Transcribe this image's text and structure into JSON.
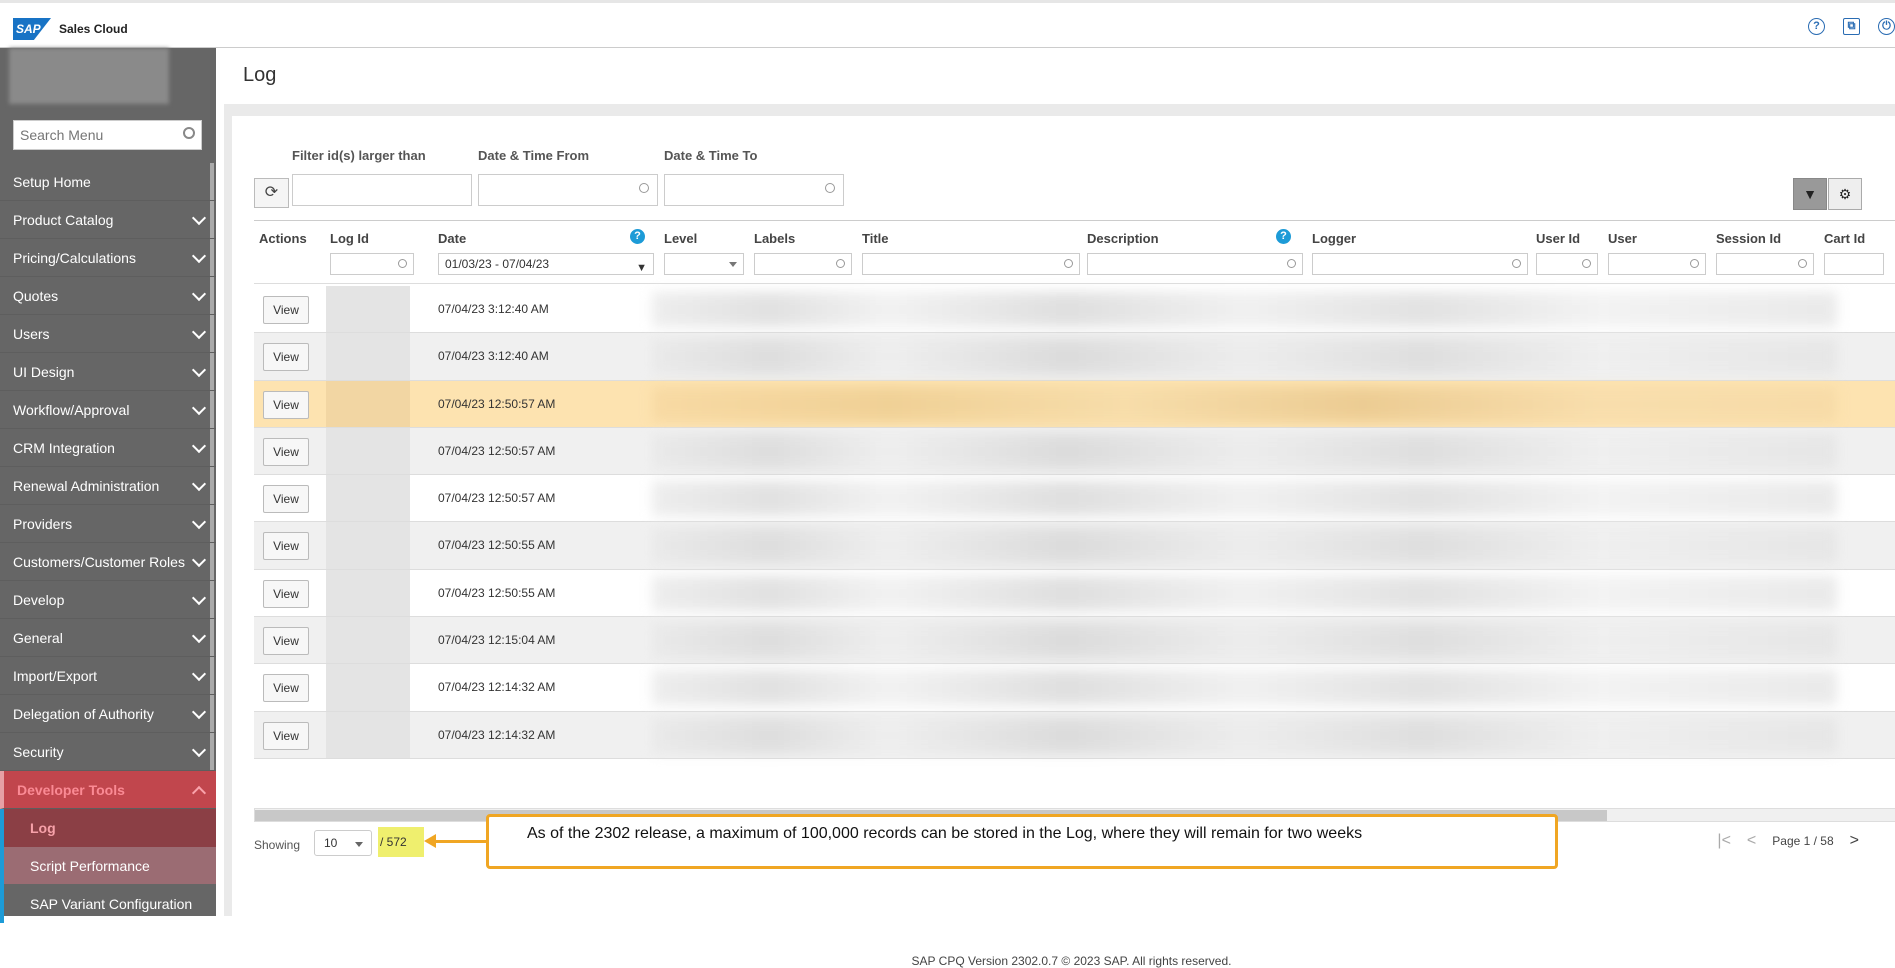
{
  "app": {
    "logo": "SAP",
    "name": "Sales Cloud"
  },
  "top_icons": [
    "help-icon",
    "external-window-icon",
    "power-icon"
  ],
  "sidebar": {
    "search_placeholder": "Search Menu",
    "items": [
      {
        "label": "Setup Home",
        "has_chevron": false
      },
      {
        "label": "Product Catalog",
        "has_chevron": true
      },
      {
        "label": "Pricing/Calculations",
        "has_chevron": true
      },
      {
        "label": "Quotes",
        "has_chevron": true
      },
      {
        "label": "Users",
        "has_chevron": true
      },
      {
        "label": "UI Design",
        "has_chevron": true
      },
      {
        "label": "Workflow/Approval",
        "has_chevron": true
      },
      {
        "label": "CRM Integration",
        "has_chevron": true
      },
      {
        "label": "Renewal Administration",
        "has_chevron": true
      },
      {
        "label": "Providers",
        "has_chevron": true
      },
      {
        "label": "Customers/Customer Roles",
        "has_chevron": true
      },
      {
        "label": "Develop",
        "has_chevron": true
      },
      {
        "label": "General",
        "has_chevron": true
      },
      {
        "label": "Import/Export",
        "has_chevron": true
      },
      {
        "label": "Delegation of Authority",
        "has_chevron": true
      },
      {
        "label": "Security",
        "has_chevron": true
      },
      {
        "label": "Developer Tools",
        "has_chevron": true,
        "active": true
      }
    ],
    "sub_items": [
      {
        "label": "Log",
        "current": true
      },
      {
        "label": "Script Performance",
        "current": false
      },
      {
        "label": "SAP Variant Configuration",
        "current": false
      }
    ]
  },
  "page": {
    "title": "Log"
  },
  "filters": {
    "id_label": "Filter id(s) larger than",
    "from_label": "Date & Time From",
    "to_label": "Date & Time To",
    "id_value": "",
    "from_value": "",
    "to_value": ""
  },
  "grid": {
    "columns": {
      "actions": "Actions",
      "log_id": "Log Id",
      "date": "Date",
      "level": "Level",
      "labels": "Labels",
      "title": "Title",
      "description": "Description",
      "logger": "Logger",
      "user_id": "User Id",
      "user": "User",
      "session_id": "Session Id",
      "cart_id": "Cart Id"
    },
    "date_filter_value": "01/03/23 - 07/04/23",
    "view_label": "View",
    "rows": [
      {
        "date": "07/04/23 3:12:40 AM"
      },
      {
        "date": "07/04/23 3:12:40 AM"
      },
      {
        "date": "07/04/23 12:50:57 AM"
      },
      {
        "date": "07/04/23 12:50:57 AM"
      },
      {
        "date": "07/04/23 12:50:57 AM"
      },
      {
        "date": "07/04/23 12:50:55 AM"
      },
      {
        "date": "07/04/23 12:50:55 AM"
      },
      {
        "date": "07/04/23 12:15:04 AM"
      },
      {
        "date": "07/04/23 12:14:32 AM"
      },
      {
        "date": "07/04/23 12:14:32 AM"
      }
    ],
    "selected_row": 2
  },
  "pagination": {
    "showing_label": "Showing",
    "page_size": "10",
    "total": "/ 572",
    "page_label": "Page 1 / 58"
  },
  "callout": {
    "text": "As of the 2302 release, a maximum of 100,000 records can be stored in the Log, where they will remain for two weeks"
  },
  "footer": {
    "text": "SAP CPQ Version 2302.0.7 © 2023 SAP. All rights reserved."
  },
  "colors": {
    "brand": "#1873c5",
    "sidebar_bg": "#666666",
    "active_menu": "#c1464d",
    "selected_row": "#fde3b0",
    "callout_border": "#f0a623",
    "count_highlight": "#efef6e"
  }
}
